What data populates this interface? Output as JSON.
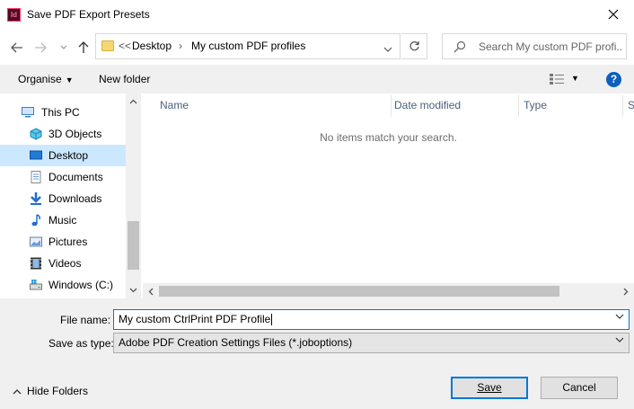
{
  "window": {
    "title": "Save PDF Export Presets",
    "app_icon_text": "Id"
  },
  "address_bar": {
    "overflow": "<<",
    "crumbs": [
      "Desktop",
      "My custom PDF profiles"
    ]
  },
  "search": {
    "placeholder": "Search My custom PDF profi..."
  },
  "toolbar": {
    "organise_label": "Organise",
    "new_folder_label": "New folder"
  },
  "nav_pane": {
    "items": [
      {
        "label": "This PC",
        "icon": "pc-icon",
        "selected": false
      },
      {
        "label": "3D Objects",
        "icon": "3d-objects-icon",
        "selected": false
      },
      {
        "label": "Desktop",
        "icon": "desktop-icon",
        "selected": true
      },
      {
        "label": "Documents",
        "icon": "documents-icon",
        "selected": false
      },
      {
        "label": "Downloads",
        "icon": "downloads-icon",
        "selected": false
      },
      {
        "label": "Music",
        "icon": "music-icon",
        "selected": false
      },
      {
        "label": "Pictures",
        "icon": "pictures-icon",
        "selected": false
      },
      {
        "label": "Videos",
        "icon": "videos-icon",
        "selected": false
      },
      {
        "label": "Windows (C:)",
        "icon": "drive-icon",
        "selected": false
      }
    ]
  },
  "file_list": {
    "columns": [
      "Name",
      "Date modified",
      "Type",
      "S"
    ],
    "empty_message": "No items match your search."
  },
  "form": {
    "file_name_label": "File name:",
    "file_name_value": "My custom CtrlPrint PDF Profile",
    "save_type_label": "Save as type:",
    "save_type_value": "Adobe PDF Creation Settings Files (*.joboptions)"
  },
  "footer": {
    "hide_folders_label": "Hide Folders",
    "save_label": "Save",
    "cancel_label": "Cancel"
  },
  "colors": {
    "accent": "#0078d7",
    "selected_bg": "#cce8ff",
    "help": "#0a5fbf"
  }
}
